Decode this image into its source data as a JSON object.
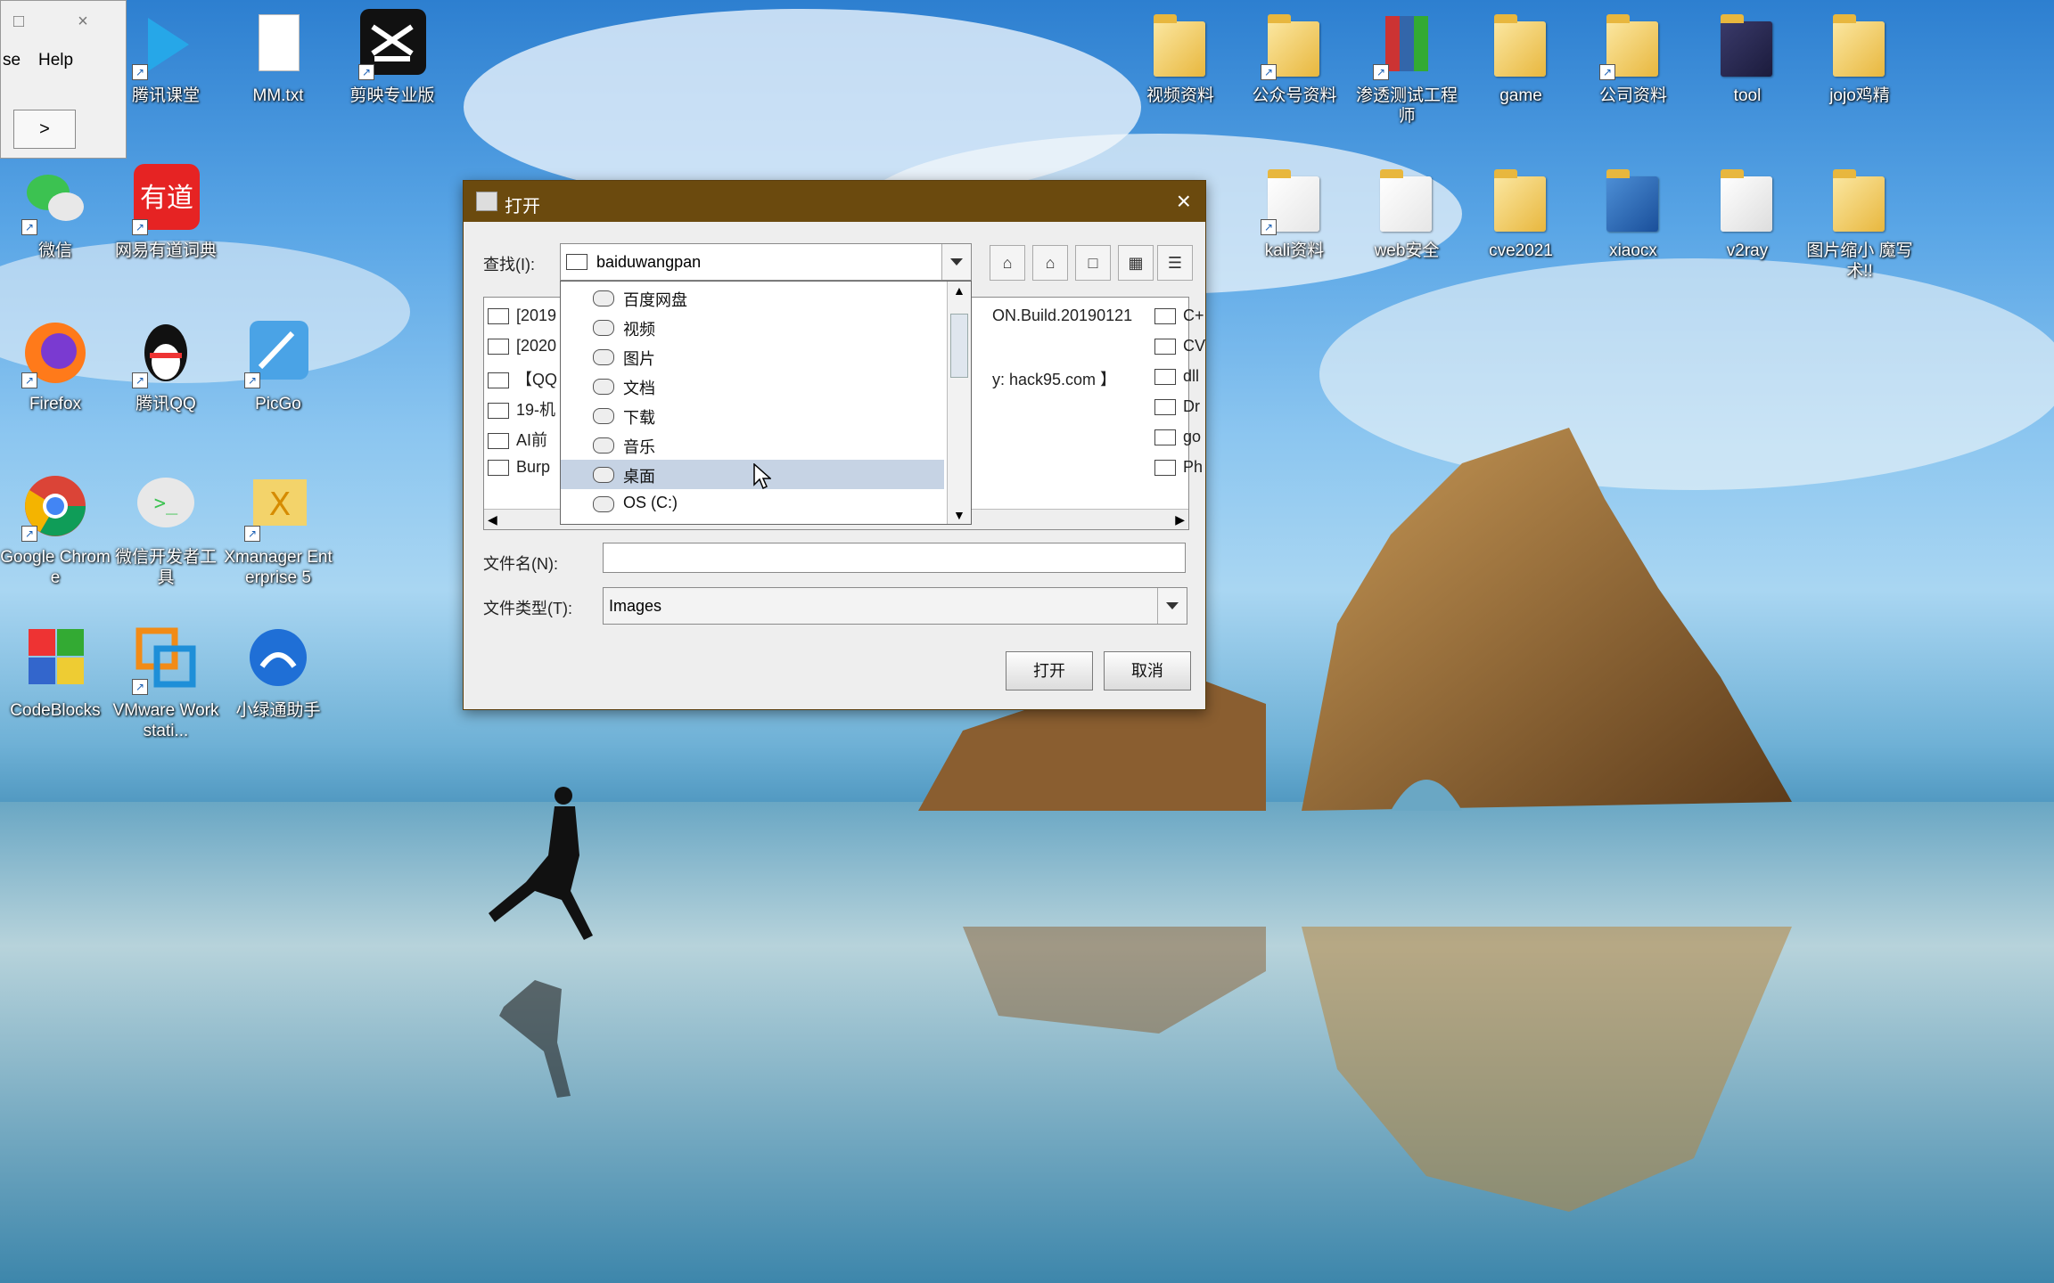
{
  "partial_window": {
    "menu_fragment": "se",
    "menu_help": "Help",
    "nav_button": ">"
  },
  "desktop_icons_left": [
    {
      "label": "腾讯课堂"
    },
    {
      "label": "MM.txt"
    },
    {
      "label": "剪映专业版"
    },
    {
      "label": "微信"
    },
    {
      "label": "网易有道词典"
    },
    {
      "label": "Firefox"
    },
    {
      "label": "腾讯QQ"
    },
    {
      "label": "PicGo"
    },
    {
      "label": "Google Chrome"
    },
    {
      "label": "微信开发者工具"
    },
    {
      "label": "Xmanager Enterprise 5"
    },
    {
      "label": "CodeBlocks"
    },
    {
      "label": "VMware Workstati..."
    },
    {
      "label": "小绿通助手"
    }
  ],
  "desktop_icons_right": [
    {
      "label": "视频资料"
    },
    {
      "label": "公众号资料"
    },
    {
      "label": "渗透测试工程师"
    },
    {
      "label": "game"
    },
    {
      "label": "公司资料"
    },
    {
      "label": "tool"
    },
    {
      "label": "jojo鸡精"
    },
    {
      "label": "kali资料"
    },
    {
      "label": "web安全"
    },
    {
      "label": "cve2021"
    },
    {
      "label": "xiaocx"
    },
    {
      "label": "v2ray"
    },
    {
      "label": "图片缩小 魔写术!!"
    }
  ],
  "dialog": {
    "title": "打开",
    "close": "×",
    "look_in_label": "查找(I):",
    "look_in_value": "baiduwangpan",
    "toolbar": [
      "⌂",
      "⌂",
      "□",
      "▦",
      "☰"
    ],
    "file_list_left": [
      "[2019",
      "[2020",
      "【QQ",
      "19-机",
      "AI前",
      "Burp"
    ],
    "file_list_mid": [
      "ON.Build.20190121",
      "y: hack95.com 】"
    ],
    "file_list_right": [
      "C+",
      "CV",
      "dll",
      "Dr",
      "go",
      "Ph"
    ],
    "dropdown_items": [
      "百度网盘",
      "视频",
      "图片",
      "文档",
      "下载",
      "音乐",
      "桌面",
      "OS (C:)"
    ],
    "dropdown_selected_index": 6,
    "filename_label": "文件名(N):",
    "filename_value": "",
    "filetype_label": "文件类型(T):",
    "filetype_value": "Images",
    "open_button": "打开",
    "cancel_button": "取消"
  }
}
